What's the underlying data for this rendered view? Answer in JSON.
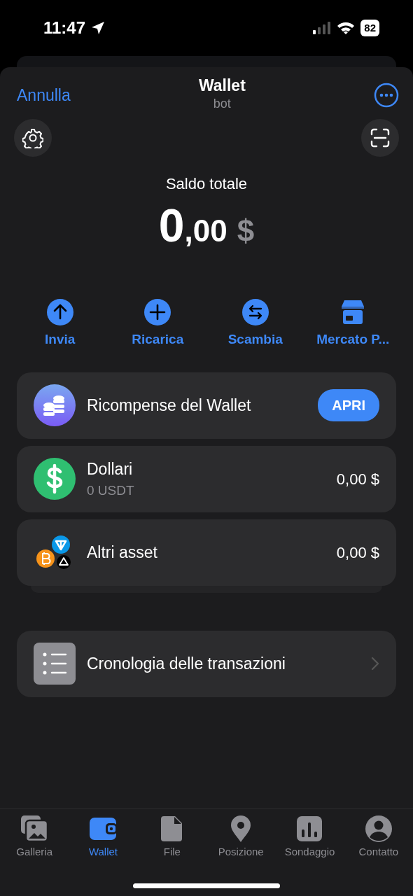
{
  "status_bar": {
    "time": "11:47",
    "battery": "82"
  },
  "header": {
    "cancel": "Annulla",
    "title": "Wallet",
    "subtitle": "bot"
  },
  "balance": {
    "label": "Saldo totale",
    "integer": "0",
    "decimal": ",00",
    "currency": "$"
  },
  "actions": [
    {
      "kind": "send",
      "label": "Invia"
    },
    {
      "kind": "topup",
      "label": "Ricarica"
    },
    {
      "kind": "swap",
      "label": "Scambia"
    },
    {
      "kind": "market",
      "label": "Mercato P..."
    }
  ],
  "rewards": {
    "title": "Ricompense del Wallet",
    "button": "APRI"
  },
  "assets": [
    {
      "kind": "dollar",
      "name": "Dollari",
      "amount": "0 USDT",
      "value": "0,00 $"
    },
    {
      "kind": "other",
      "name": "Altri asset",
      "value": "0,00 $"
    }
  ],
  "history": {
    "title": "Cronologia delle transazioni"
  },
  "tabs": [
    {
      "kind": "gallery",
      "label": "Galleria",
      "selected": false
    },
    {
      "kind": "wallet",
      "label": "Wallet",
      "selected": true
    },
    {
      "kind": "file",
      "label": "File",
      "selected": false
    },
    {
      "kind": "location",
      "label": "Posizione",
      "selected": false
    },
    {
      "kind": "poll",
      "label": "Sondaggio",
      "selected": false
    },
    {
      "kind": "contact",
      "label": "Contatto",
      "selected": false
    }
  ]
}
